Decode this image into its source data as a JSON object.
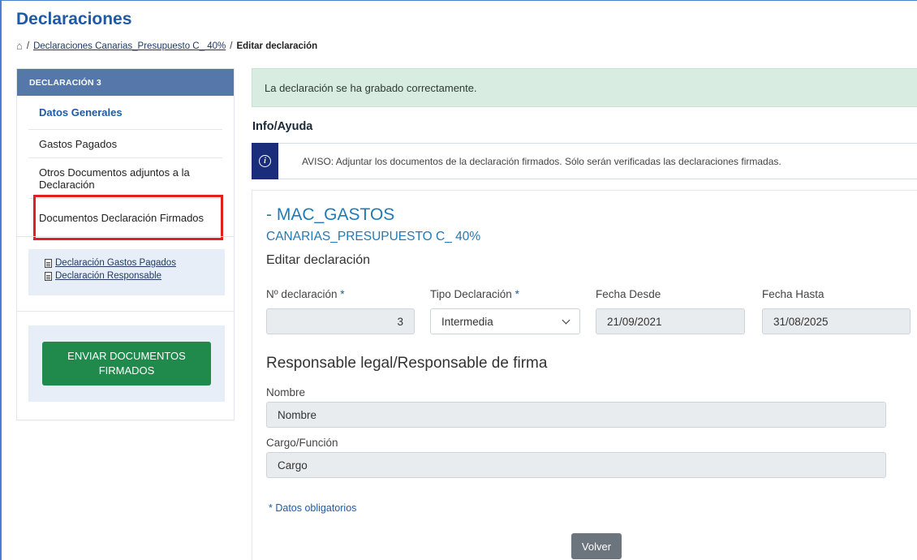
{
  "page": {
    "title": "Declaraciones"
  },
  "breadcrumb": {
    "home_icon": "home-icon",
    "separator": "/",
    "link": "Declaraciones Canarias_Presupuesto C_ 40%",
    "current": "Editar declaración"
  },
  "sidebar": {
    "header": "DECLARACIÓN 3",
    "items": [
      {
        "label": "Datos Generales",
        "active": true
      },
      {
        "label": "Gastos Pagados",
        "active": false
      },
      {
        "label": "Otros Documentos adjuntos a la Declaración",
        "active": false
      },
      {
        "label": "Documentos Declaración Firmados",
        "active": false
      }
    ],
    "highlight_color": "#e02020",
    "documents": [
      {
        "label": "Declaración Gastos Pagados",
        "icon": "document-icon"
      },
      {
        "label": "Declaración Responsable",
        "icon": "document-icon"
      }
    ],
    "send_button": "ENVIAR DOCUMENTOS FIRMADOS"
  },
  "alert": {
    "message": "La declaración se ha grabado correctamente."
  },
  "help": {
    "title": "Info/Ayuda",
    "icon": "info-icon",
    "notice": "AVISO: Adjuntar los documentos de la declaración firmados. Sólo serán verificadas las declaraciones firmadas."
  },
  "form": {
    "title": "- MAC_GASTOS",
    "subtitle": "CANARIAS_PRESUPUESTO C_ 40%",
    "heading": "Editar declaración",
    "fields": {
      "numero": {
        "label": "Nº declaración",
        "required": "*",
        "value": "3"
      },
      "tipo": {
        "label": "Tipo Declaración",
        "required": "*",
        "value": "Intermedia"
      },
      "desde": {
        "label": "Fecha Desde",
        "value": "21/09/2021"
      },
      "hasta": {
        "label": "Fecha Hasta",
        "value": "31/08/2025"
      }
    },
    "responsable": {
      "heading": "Responsable legal/Responsable de firma",
      "nombre": {
        "label": "Nombre",
        "value": "Nombre"
      },
      "cargo": {
        "label": "Cargo/Función",
        "value": "Cargo"
      }
    },
    "required_note": "* Datos obligatorios",
    "back_button": "Volver"
  },
  "colors": {
    "primary": "#1f5aa6",
    "sidebar_header": "#5577a9",
    "success_bg": "#d8ece2",
    "send_button": "#1f8a4c",
    "notice_icon_bg": "#1a2d7a"
  }
}
